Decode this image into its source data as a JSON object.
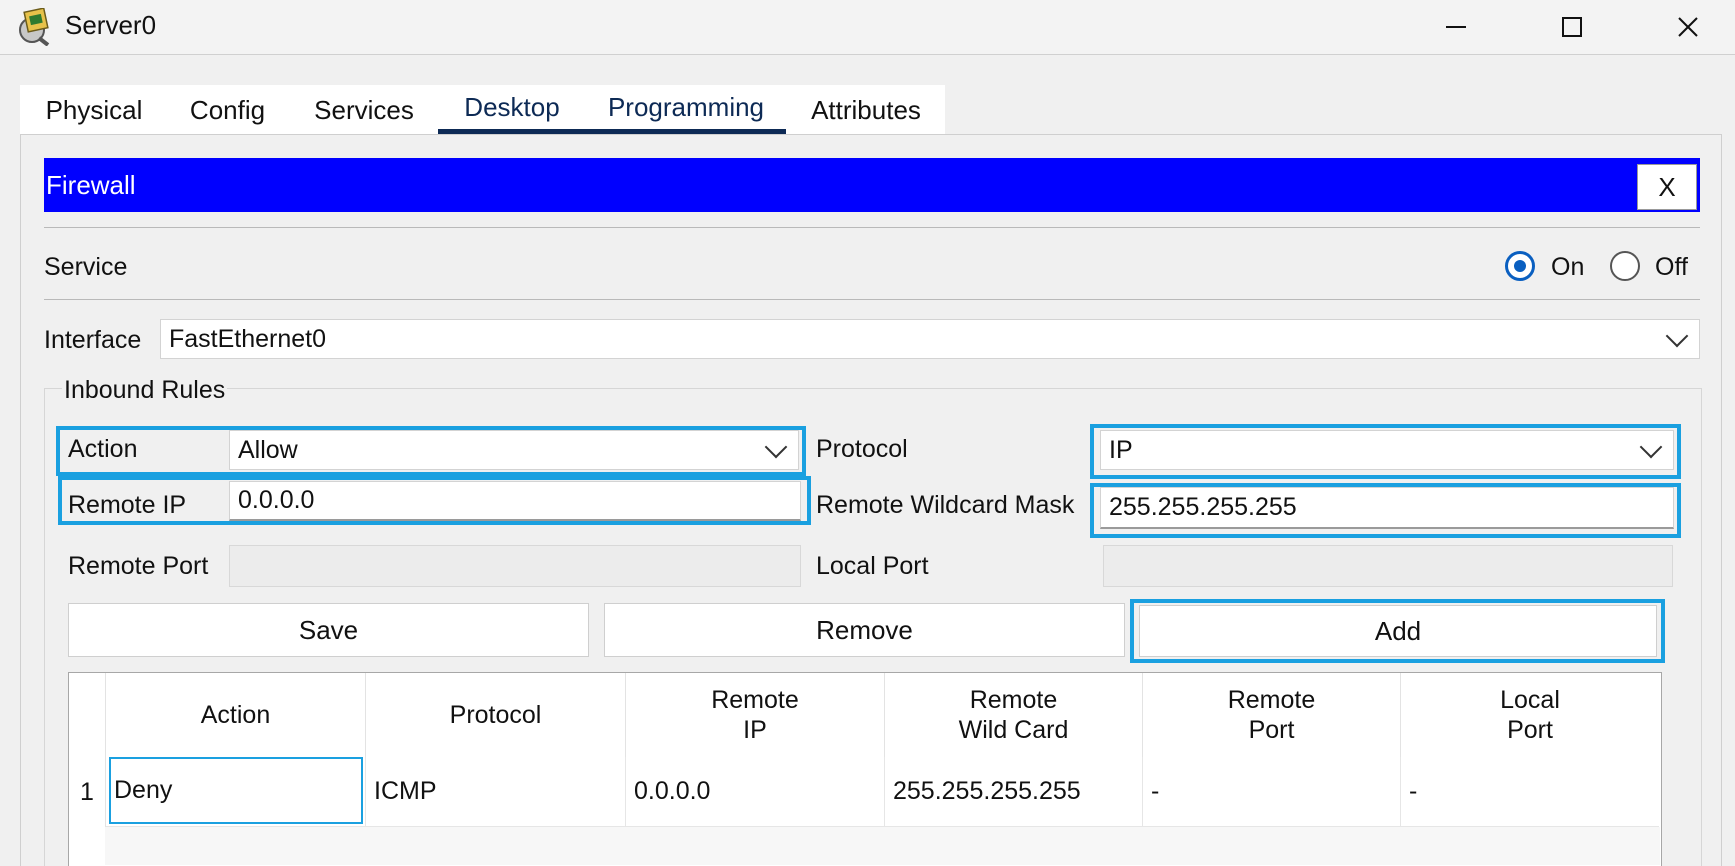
{
  "window": {
    "title": "Server0",
    "minimize": "─",
    "maximize": "☐",
    "close": "✕"
  },
  "tabs": [
    {
      "label": "Physical"
    },
    {
      "label": "Config"
    },
    {
      "label": "Services"
    },
    {
      "label": "Desktop"
    },
    {
      "label": "Programming"
    },
    {
      "label": "Attributes"
    }
  ],
  "active_tab": "Desktop",
  "firewall": {
    "title": "Firewall",
    "close_label": "X"
  },
  "service": {
    "label": "Service",
    "on_label": "On",
    "off_label": "Off",
    "selected": "On"
  },
  "interface": {
    "label": "Interface",
    "value": "FastEthernet0"
  },
  "inbound": {
    "title": "Inbound Rules",
    "action_label": "Action",
    "action_value": "Allow",
    "protocol_label": "Protocol",
    "protocol_value": "IP",
    "remote_ip_label": "Remote IP",
    "remote_ip_value": "0.0.0.0",
    "wildcard_label": "Remote Wildcard Mask",
    "wildcard_value": "255.255.255.255",
    "remote_port_label": "Remote Port",
    "remote_port_value": "",
    "local_port_label": "Local Port",
    "local_port_value": ""
  },
  "buttons": {
    "save": "Save",
    "remove": "Remove",
    "add": "Add"
  },
  "table": {
    "headers": [
      {
        "line1": "Action",
        "line2": ""
      },
      {
        "line1": "Protocol",
        "line2": ""
      },
      {
        "line1": "Remote",
        "line2": "IP"
      },
      {
        "line1": "Remote",
        "line2": "Wild Card"
      },
      {
        "line1": "Remote",
        "line2": "Port"
      },
      {
        "line1": "Local",
        "line2": "Port"
      }
    ],
    "rows": [
      {
        "num": "1",
        "action": "Deny",
        "protocol": "ICMP",
        "remote_ip": "0.0.0.0",
        "wildcard": "255.255.255.255",
        "remote_port": "-",
        "local_port": "-"
      }
    ]
  },
  "colors": {
    "firewall_header": "#0000ff",
    "highlight": "#1aa0e0",
    "tab_underline": "#0d2a55",
    "radio_selected": "#0a5fc0"
  }
}
